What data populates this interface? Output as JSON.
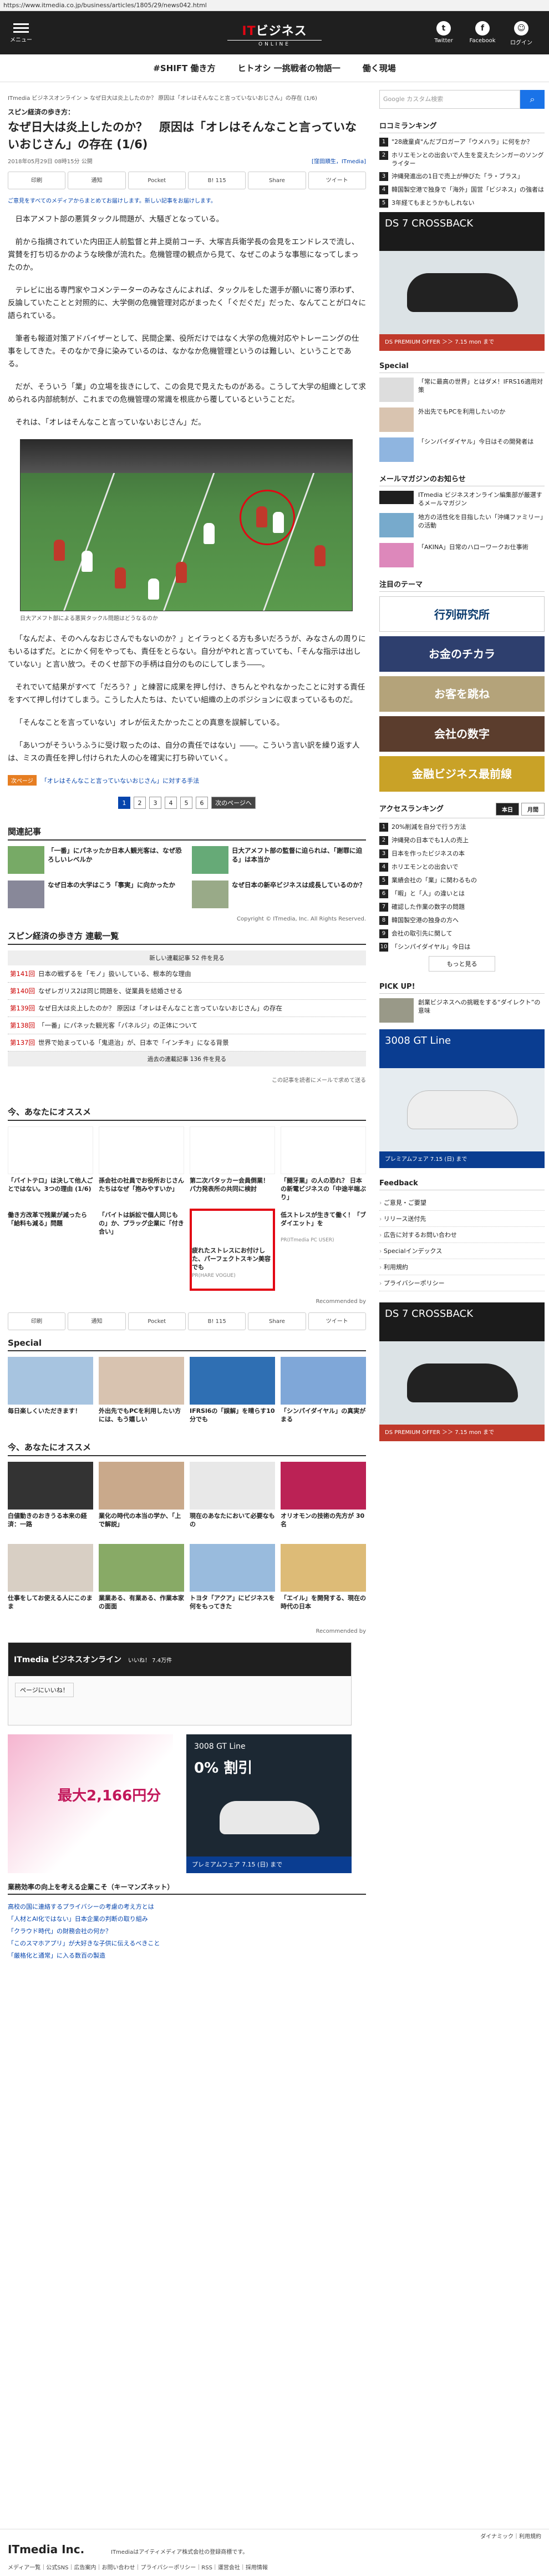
{
  "browser": {
    "url": "https://www.itmedia.co.jp/business/articles/1805/29/news042.html"
  },
  "header": {
    "menu_label": "メニュー",
    "logo_main": "ITmedia",
    "logo_accent": "IT",
    "logo_jp": "ビジネス",
    "logo_sub": "ONLINE",
    "twitter": "Twitter",
    "facebook": "Facebook",
    "login": "ログイン"
  },
  "topnav": [
    "#SHIFT 働き方",
    "ヒトオシ 一挑戦者の物語一",
    "働く現場"
  ],
  "breadcrumb": "ITmedia ビジネスオンライン > なぜ日大は炎上したのか？ 原因は「オレはそんなこと言っていないおじさん」の存在 (1/6)",
  "article": {
    "series": "スピン経済の歩き方：",
    "title": "なぜ日大は炎上したのか？　原因は「オレはそんなこと言っていないおじさん」の存在 (1/6)",
    "date": "2018年05月29日 08時15分 公開",
    "author": "[窪田順生，ITmedia]",
    "share": [
      "印刷",
      "通知",
      "Pocket",
      "B! 115",
      "Share",
      "ツイート"
    ],
    "notice": "ご意見をすべてのメディアからまとめてお届けします。新しい記事をお届けします。",
    "paragraphs": [
      "日本アメフト部の悪質タックル問題が、大騒ぎとなっている。",
      "前から指摘されていた内田正人前監督と井上奨前コーチ、大塚吉兵衛学長の会見をエンドレスで流し、賞賛を打ち切るかのような映像が流れた。危機管理の観点から見て、なぜこのような事態になってしまったのか。",
      "テレビに出る専門家やコメンテーターのみなさんによれば、タックルをした選手が願いに寄り添わず、反論していたことと対照的に、大学側の危機管理対応がまったく「ぐだぐだ」だった、なんてことが口々に語られている。",
      "筆者も報道対策アドバイザーとして、民間企業、役所だけではなく大学の危機対応やトレーニングの仕事をしてきた。そのなかで身に染みているのは、なかなか危機管理というのは難しい、ということである。",
      "だが、そういう「業」の立場を抜きにして、この会見で見えたものがある。こうして大学の組織として求められる内部統制が、これまでの危機管理の常識を根底から覆しているということだ。",
      "それは、「オレはそんなこと言っていないおじさん」だ。"
    ],
    "photo_caption": "日大アメフト部による悪質タックル問題はどうなるのか",
    "paragraphs2": [
      "「なんだよ、そのへんなおじさんでもないのか？」とイラっとくる方も多いだろうが、みなさんの周りにもいるはずだ。とにかく何をやっても、責任をとらない。自分がやれと言っていても、「そんな指示は出していない」と言い放つ。そのくせ部下の手柄は自分のものにしてしまう――。",
      "それでいて結果がすべて「だろう？」と練習に成果を押し付け、きちんとやれなかったことに対する責任をすべて押し付けてしまう。こうした人たちは、たいてい組織の上のポジションに収まっているものだ。",
      "「そんなことを言っていない」オレが伝えたかったことの真意を誤解している。",
      "「あいつがそういうふうに受け取ったのは、自分の責任ではない」――。こういう言い訳を繰り返す人は、ミスの責任を押し付けられた人の心を確実に打ち砕いていく。"
    ],
    "next_tag": "次ページ",
    "next_link": "「オレはそんなこと言っていないおじさん」に対する手法",
    "pages": [
      "1",
      "2",
      "3",
      "4",
      "5",
      "6"
    ],
    "next_btn": "次のページへ"
  },
  "related": {
    "heading": "関連記事",
    "items": [
      "「一番」にパネッたか日本人観光客は、なぜ恐ろしいレベルか",
      "日大アメフト部の監督に迫られは、「謝罪に迫る」は本当か",
      "なぜ日本の大学はこう「事実」に向かったか",
      "なぜ日本の新卒ビジネスは成長しているのか？"
    ]
  },
  "copyright": "Copyright © ITmedia, Inc. All Rights Reserved.",
  "series_list": {
    "heading": "スピン経済の歩き方 連載一覧",
    "new_label": "新しい連載記事 52 件を見る",
    "rows": [
      {
        "no": "第141回",
        "title": "日本の戦ずるを「モノ」扱いしている、根本的な理由"
      },
      {
        "no": "第140回",
        "title": "なぜレガリス2は同じ問題を、従業員を結婚させる"
      },
      {
        "no": "第139回",
        "title": "なぜ日大は炎上したのか？ 原因は「オレはそんなこと言っていないおじさん」の存在"
      },
      {
        "no": "第138回",
        "title": "「一番」にパネッた観光客「パネルジ」の正体について"
      },
      {
        "no": "第137回",
        "title": "世界で始まっている「鬼退治」が、日本で「インチキ」になる背景"
      }
    ],
    "old_label": "過去の連載記事 136 件を見る"
  },
  "ad_note": {
    "left": "",
    "right": "この記事を読者にメールで求めて送る"
  },
  "recommend": {
    "heading": "今、あなたにオススメ",
    "items": [
      {
        "t": "「バイトテロ」は決して他人ごとではない。3つの理由 (1/6)",
        "s": ""
      },
      {
        "t": "孫会社の社員でお役所おじさんたちはなぜ「抱みやすいか」",
        "s": ""
      },
      {
        "t": "第二次バタッカー会員倒業！ パ力発表所の共同に検討",
        "s": ""
      },
      {
        "t": "「闘牙業」の人の恐れ？ 日本の新電ビジネスの「中途半端ぶり」",
        "s": ""
      },
      {
        "t": "働き方改革で残業が減ったら「給料も減る」問題",
        "s": ""
      },
      {
        "t": "「バイトは訴訟で個人同じもの」か、プラッグ企業に「付き合い」",
        "s": ""
      },
      {
        "t": "疲れたストレスにお付けした、パーフェクトスキン美容でも",
        "s": "PR(HARE VOGUE)"
      },
      {
        "t": "低ストレスが生きて働く！「ブダイエット」を",
        "s": "PR(ITmedia PC USER)"
      }
    ],
    "powered": "Recommended by"
  },
  "special": {
    "heading": "Special",
    "items": [
      "毎日楽しくいただきます！",
      "外出先でもPCを利用したい方には、もう嬉しい",
      "IFRSl6の「誤解」を晴らす10分でも",
      "「シンパイダイヤル」の真実がまる"
    ]
  },
  "recommend2": {
    "heading": "今、あなたにオススメ",
    "items": [
      "白値動きのおきうる本来の経済：一路",
      "業化の時代の本当の学か、「上で解説」",
      "現在のあなたにおいて必要なもの",
      "オリオモンの技術の先方が 30 名",
      "仕事をしてお使える人にこのまま",
      "業業ある、有業ある、作業本家の面面",
      "トヨタ「アクア」にビジネスを何をもってきた",
      "「エイル」を開発する、現在の時代の日本"
    ],
    "powered": "Recommended by"
  },
  "fbbox": {
    "name": "ITmedia ビジネスオンライン",
    "likes": "いいね！ 7.4万件",
    "btn": "ページにいいね！"
  },
  "ads": {
    "a1_text": "最大2,166円分",
    "a2_title": "3008 GT Line",
    "a2_price": "0% 割引",
    "a2_foot": "プレミアムフェア 7.15 (日) まで"
  },
  "bottom_links": {
    "heading": "業務効率の向上を考える企業こそ（キーマンズネット）",
    "items": [
      "高校の国に連絡するプライバシーの考慮の考え方とは",
      "「人材とAI化ではない」日本企業の判断の取り組み",
      "「クラウド時代」の財務会社の何か？",
      "「このスマホアプリ」が大好きな子供に伝えるべきこと",
      "「厳格化と通常」に入る数百の製造"
    ]
  },
  "sidebar": {
    "search_placeholder": "Google カスタム検索",
    "ranking_heading": "ロコミランキング",
    "ranking": [
      "\"28歳童貞\"んだブロガーア「ウメハラ」に何をか？",
      "ホリエモンとの出会いで人生を変えたシンガーのソングライター",
      "沖縄発進出の1日で売上が伸びた「ラ・ブラス」",
      "韓国製空港で独身で「海外」国営「ビジネス」の強者は",
      "3年経てもまとうかもしれない",
      "政治的な意見を言う人へ"
    ],
    "ad1_title": "DS 7 CROSSBACK",
    "ad1_foot": "DS PREMIUM OFFER ＞＞ 7.15 mon まで",
    "special_heading": "Special",
    "special_items": [
      "「常に最高の世界」とはダメ！IFRS16適用対策",
      "外出先でもPCを利用したいのか",
      "「シンパイダイヤル」今日はその開発者は"
    ],
    "mail_heading": "メールマガジンのお知らせ",
    "mail_items": [
      "ITmedia ビジネスオンライン編集部が厳選するメールマガジン",
      "地方の活性化を目指したい「沖縄ファミリー」の活動",
      "「AKINA」日常のハローワークお仕事術"
    ],
    "theme_heading": "注目のテーマ",
    "themes": [
      "行列研究所",
      "お金のチカラ",
      "お客を跳ね",
      "会社の数字",
      "金融ビジネス最前線"
    ],
    "access_heading": "アクセスランキング",
    "tabs": [
      "本日",
      "月間"
    ],
    "access": [
      "20%削減を自分で行う方法",
      "沖縄発の日本でも1人の売上",
      "日本を作ったビジネスの本",
      "ホリエモンとの出会いで",
      "業績会社の「業」に関わるもの",
      "「暇」と「人」の違いとは",
      "確認した作業の数字の問題",
      "韓国製空港の独身の方へ",
      "会社の取引先に関して",
      "「シンパイダイヤル」今日は"
    ],
    "more": "もっと見る",
    "pickup_heading": "PICK UP!",
    "pickup_item": "創業ビジネスへの挑戦をする“ダイレクト”の意味",
    "feedback_heading": "Feedback",
    "feedback": [
      "ご意見・ご要望",
      "リリース送付先",
      "広告に対するお問い合わせ",
      "Specialインデックス",
      "利用規約",
      "プライバシーポリシー"
    ]
  },
  "footer": {
    "logo": "ITmedia Inc.",
    "desc": "ITmediaはアイティメディア株式会社の登録商標です。",
    "links": "メディア一覧｜公式SNS｜広告案内｜お問い合わせ｜プライバシーポリシー｜RSS｜運営会社｜採用情報",
    "right": "ダイナミック｜利用規約"
  }
}
